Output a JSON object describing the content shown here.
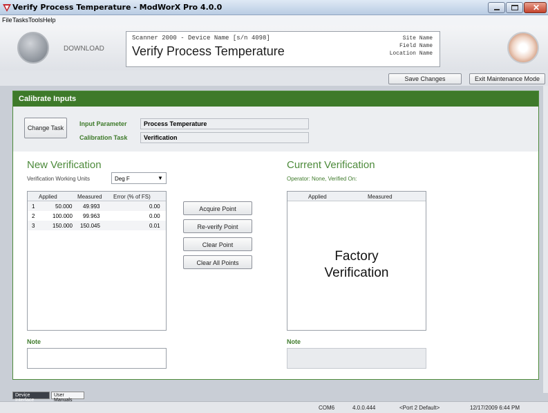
{
  "window": {
    "title": "Verify Process Temperature - ModWorX Pro 4.0.0"
  },
  "menu": [
    "File",
    "Tasks",
    "Tools",
    "Help"
  ],
  "header": {
    "download_label": "DOWNLOAD",
    "device_line": "Scanner 2000 - Device Name [s/n 4098]",
    "page_title": "Verify Process Temperature",
    "site_name": "Site Name",
    "field_name": "Field Name",
    "location_name": "Location Name"
  },
  "actions": {
    "save_label": "Save Changes",
    "exit_label": "Exit Maintenance Mode"
  },
  "section": {
    "title": "Calibrate Inputs"
  },
  "task": {
    "change_task_label": "Change Task",
    "input_param_label": "Input Parameter",
    "input_param_value": "Process Temperature",
    "cal_task_label": "Calibration Task",
    "cal_task_value": "Verification"
  },
  "new_verification": {
    "heading": "New Verification",
    "units_label": "Verification Working Units",
    "units_value": "Deg F",
    "columns": [
      "Applied",
      "Measured",
      "Error (% of FS)"
    ],
    "rows": [
      [
        "1",
        "50.000",
        "49.993",
        "0.00"
      ],
      [
        "2",
        "100.000",
        "99.963",
        "0.00"
      ],
      [
        "3",
        "150.000",
        "150.045",
        "0.01"
      ]
    ],
    "note_label": "Note"
  },
  "buttons": {
    "acquire": "Acquire Point",
    "reverify": "Re-verify Point",
    "clear": "Clear Point",
    "clear_all": "Clear All Points"
  },
  "current_verification": {
    "heading": "Current Verification",
    "operator_text": "Operator: None, Verified On:",
    "columns": [
      "Applied",
      "Measured"
    ],
    "factory_line1": "Factory",
    "factory_line2": "Verification",
    "note_label": "Note"
  },
  "bottom_tabs": [
    "Device Interface",
    "User Manuals"
  ],
  "status": {
    "port": "COM6",
    "version": "4.0.0.444",
    "port_default": "<Port 2 Default>",
    "datetime": "12/17/2009 6:44 PM"
  },
  "colors": {
    "accent": "#3e7a2a",
    "window_close": "#c4432c"
  }
}
